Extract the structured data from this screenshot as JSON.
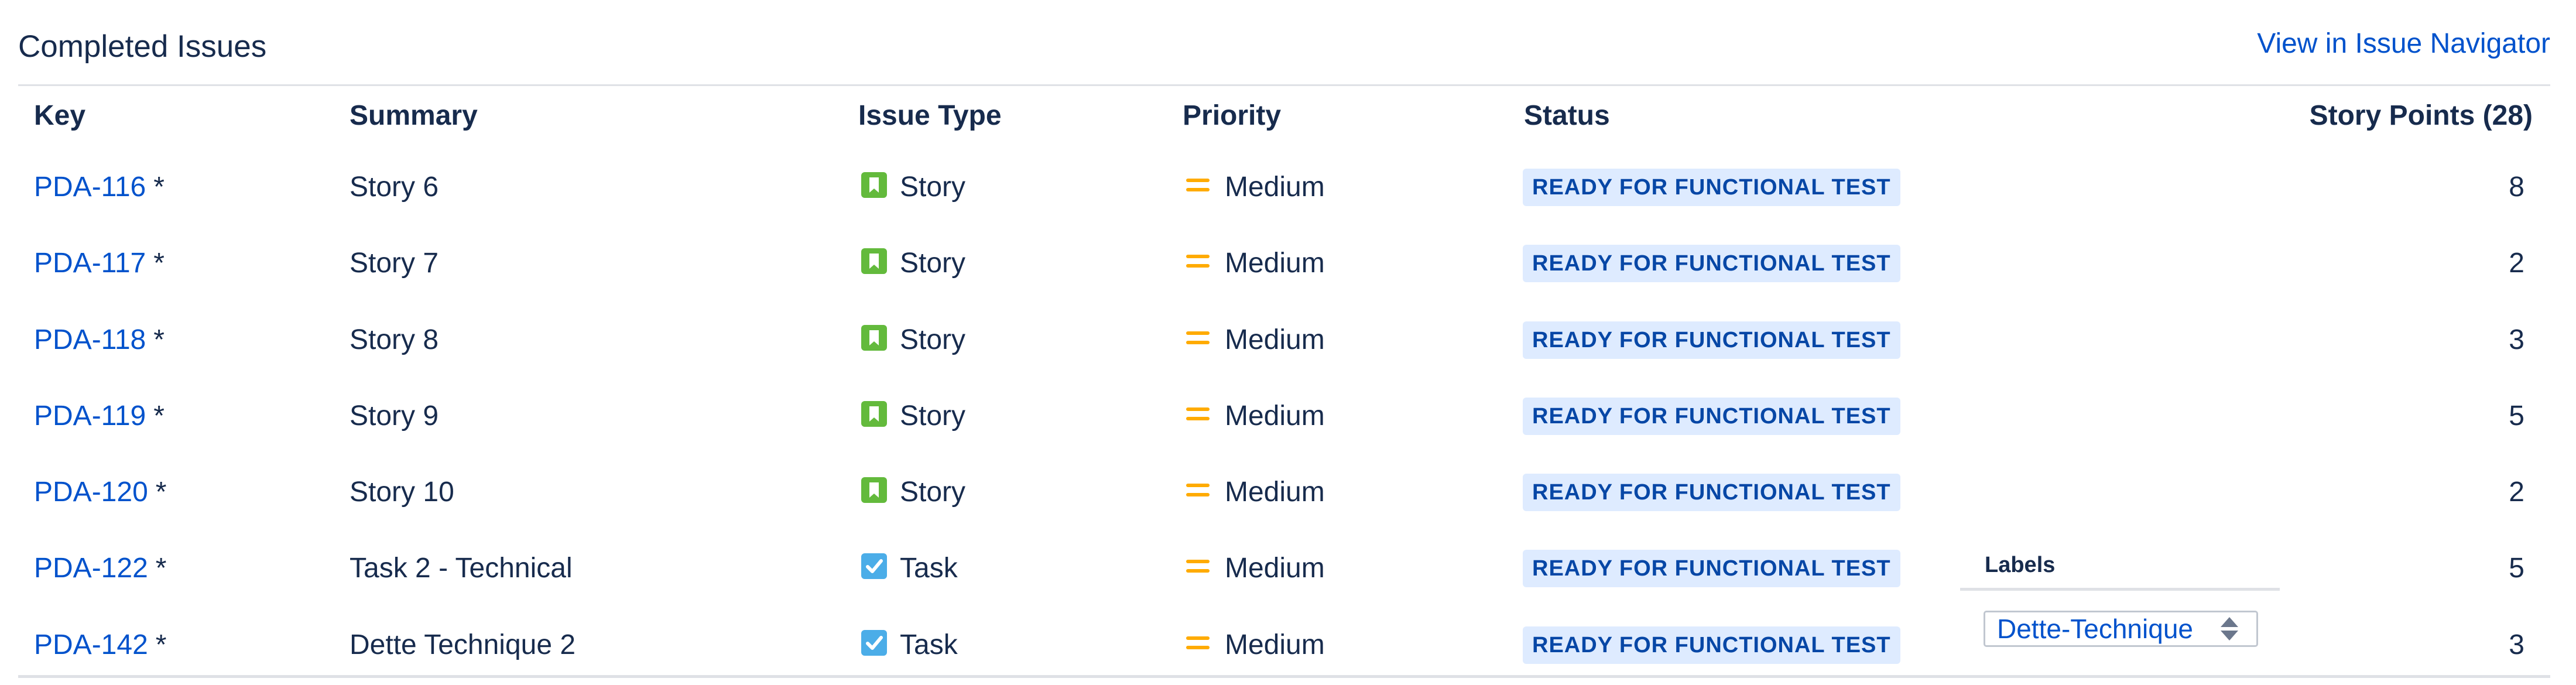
{
  "header": {
    "title": "Completed Issues",
    "navigator_link": "View in Issue Navigator"
  },
  "table": {
    "columns": {
      "key": "Key",
      "summary": "Summary",
      "type": "Issue Type",
      "priority": "Priority",
      "status": "Status",
      "points": "Story Points (28)"
    },
    "rows": [
      {
        "key": "PDA-116",
        "marker": "*",
        "summary": "Story 6",
        "type": "Story",
        "type_icon": "story-icon",
        "priority": "Medium",
        "priority_icon": "priority-medium-icon",
        "status": "READY FOR FUNCTIONAL TEST",
        "points": "8"
      },
      {
        "key": "PDA-117",
        "marker": "*",
        "summary": "Story 7",
        "type": "Story",
        "type_icon": "story-icon",
        "priority": "Medium",
        "priority_icon": "priority-medium-icon",
        "status": "READY FOR FUNCTIONAL TEST",
        "points": "2"
      },
      {
        "key": "PDA-118",
        "marker": "*",
        "summary": "Story 8",
        "type": "Story",
        "type_icon": "story-icon",
        "priority": "Medium",
        "priority_icon": "priority-medium-icon",
        "status": "READY FOR FUNCTIONAL TEST",
        "points": "3"
      },
      {
        "key": "PDA-119",
        "marker": "*",
        "summary": "Story 9",
        "type": "Story",
        "type_icon": "story-icon",
        "priority": "Medium",
        "priority_icon": "priority-medium-icon",
        "status": "READY FOR FUNCTIONAL TEST",
        "points": "5"
      },
      {
        "key": "PDA-120",
        "marker": "*",
        "summary": "Story 10",
        "type": "Story",
        "type_icon": "story-icon",
        "priority": "Medium",
        "priority_icon": "priority-medium-icon",
        "status": "READY FOR FUNCTIONAL TEST",
        "points": "2"
      },
      {
        "key": "PDA-122",
        "marker": "*",
        "summary": "Task 2 - Technical",
        "type": "Task",
        "type_icon": "task-icon",
        "priority": "Medium",
        "priority_icon": "priority-medium-icon",
        "status": "READY FOR FUNCTIONAL TEST",
        "points": "5"
      },
      {
        "key": "PDA-142",
        "marker": "*",
        "summary": "Dette Technique 2",
        "type": "Task",
        "type_icon": "task-icon",
        "priority": "Medium",
        "priority_icon": "priority-medium-icon",
        "status": "READY FOR FUNCTIONAL TEST",
        "points": "3"
      }
    ]
  },
  "labels_popup": {
    "heading": "Labels",
    "selected_value": "Dette-Technique",
    "arrows_icon": "select-updown-icon"
  },
  "colors": {
    "link": "#0052cc",
    "text": "#172b4d",
    "story": "#63ba3c",
    "task": "#4bade8",
    "priority_medium": "#ffab00",
    "status_bg": "#deebff",
    "status_text": "#0747a6",
    "rule": "#dfe1e6"
  }
}
